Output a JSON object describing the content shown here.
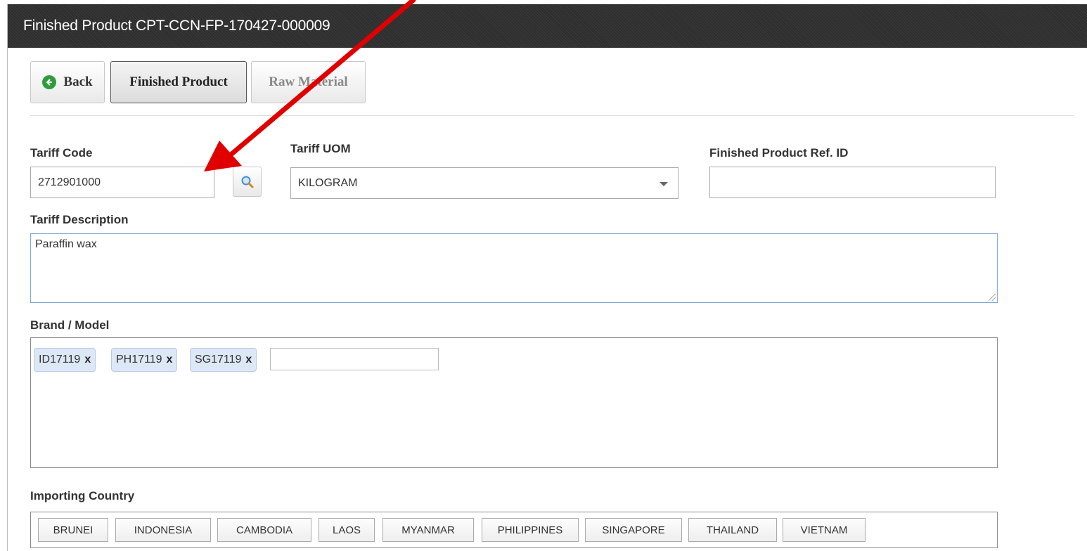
{
  "window": {
    "title": "Finished Product CPT-CCN-FP-170427-000009"
  },
  "toolbar": {
    "back_label": "Back",
    "finished_product_label": "Finished Product",
    "raw_material_label": "Raw Material"
  },
  "form": {
    "tariff_code": {
      "label": "Tariff Code",
      "value": "2712901000"
    },
    "tariff_uom": {
      "label": "Tariff UOM",
      "value": "KILOGRAM"
    },
    "finished_product_ref": {
      "label": "Finished Product Ref. ID",
      "value": ""
    },
    "tariff_description": {
      "label": "Tariff Description",
      "value": "Paraffin wax"
    },
    "brand_model": {
      "label": "Brand / Model",
      "tags": [
        "ID17119",
        "PH17119",
        "SG17119"
      ],
      "remove_glyph": "x"
    },
    "importing_country": {
      "label": "Importing Country",
      "countries": [
        "BRUNEI",
        "INDONESIA",
        "CAMBODIA",
        "LAOS",
        "MYANMAR",
        "PHILIPPINES",
        "SINGAPORE",
        "THAILAND",
        "VIETNAM"
      ]
    }
  },
  "colors": {
    "annotation_arrow": "#e00000",
    "back_icon": "#2f9b3b",
    "tag_bg": "#dde8f7",
    "focus_border": "#7aaad9"
  },
  "icons": {
    "back": "back-circle-arrow-icon",
    "search": "magnifier-icon",
    "dropdown": "chevron-down-icon",
    "annotation": "red-arrow-icon"
  }
}
